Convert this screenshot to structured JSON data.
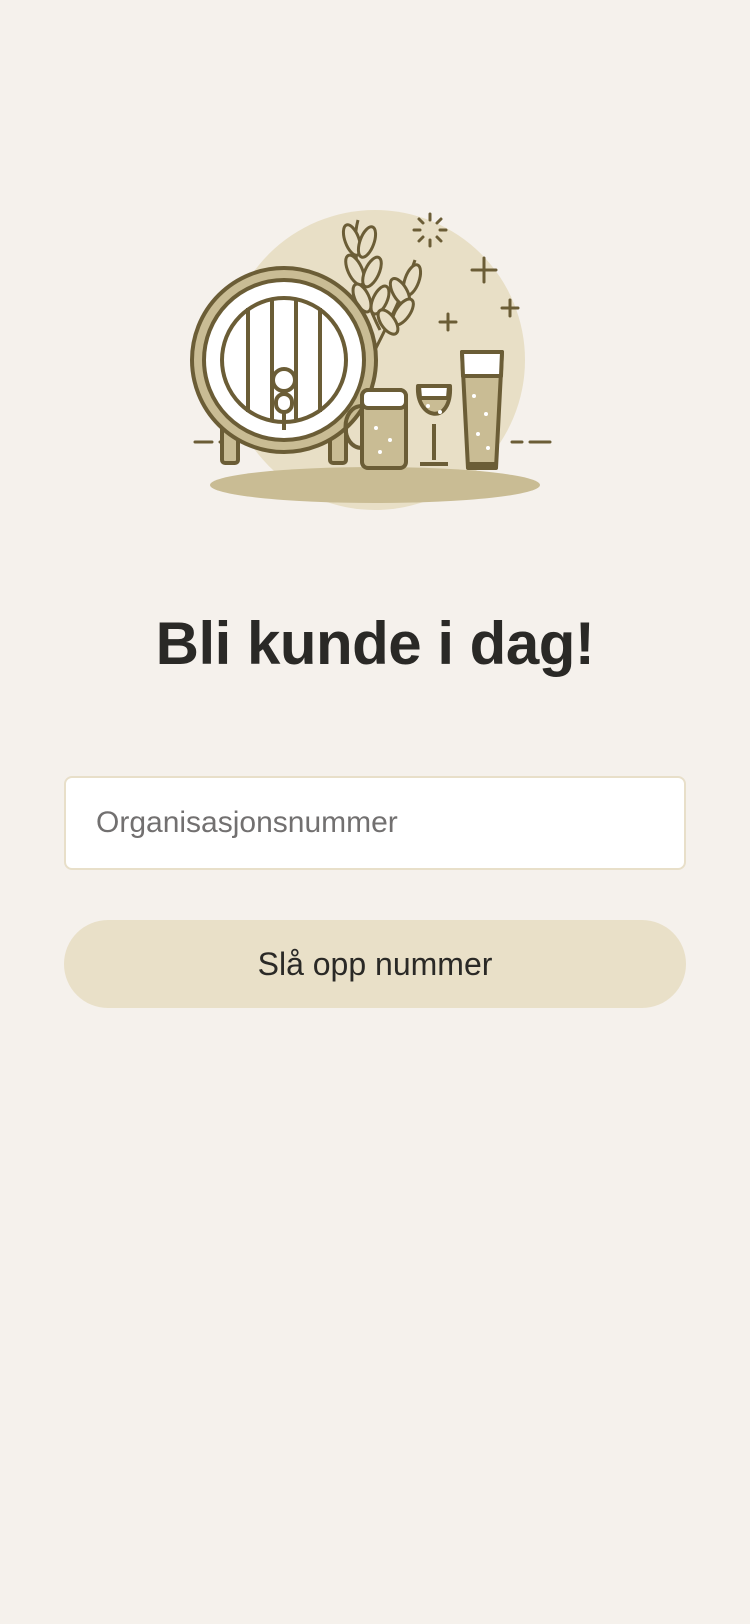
{
  "illustration": {
    "name": "beer-barrel-and-glasses-illustration",
    "colors": {
      "outline": "#6b5d36",
      "fill_light": "#e8dfc6",
      "fill_mid": "#c9bc94",
      "fill_white": "#ffffff"
    }
  },
  "title": "Bli kunde i dag!",
  "org_field": {
    "placeholder": "Organisasjonsnummer",
    "value": ""
  },
  "lookup_button": {
    "label": "Slå opp nummer"
  },
  "colors": {
    "background": "#f5f1ec",
    "button_bg": "#e9e0c8",
    "input_border": "#e8dfc9",
    "text": "#2a2926",
    "placeholder": "#727070"
  }
}
